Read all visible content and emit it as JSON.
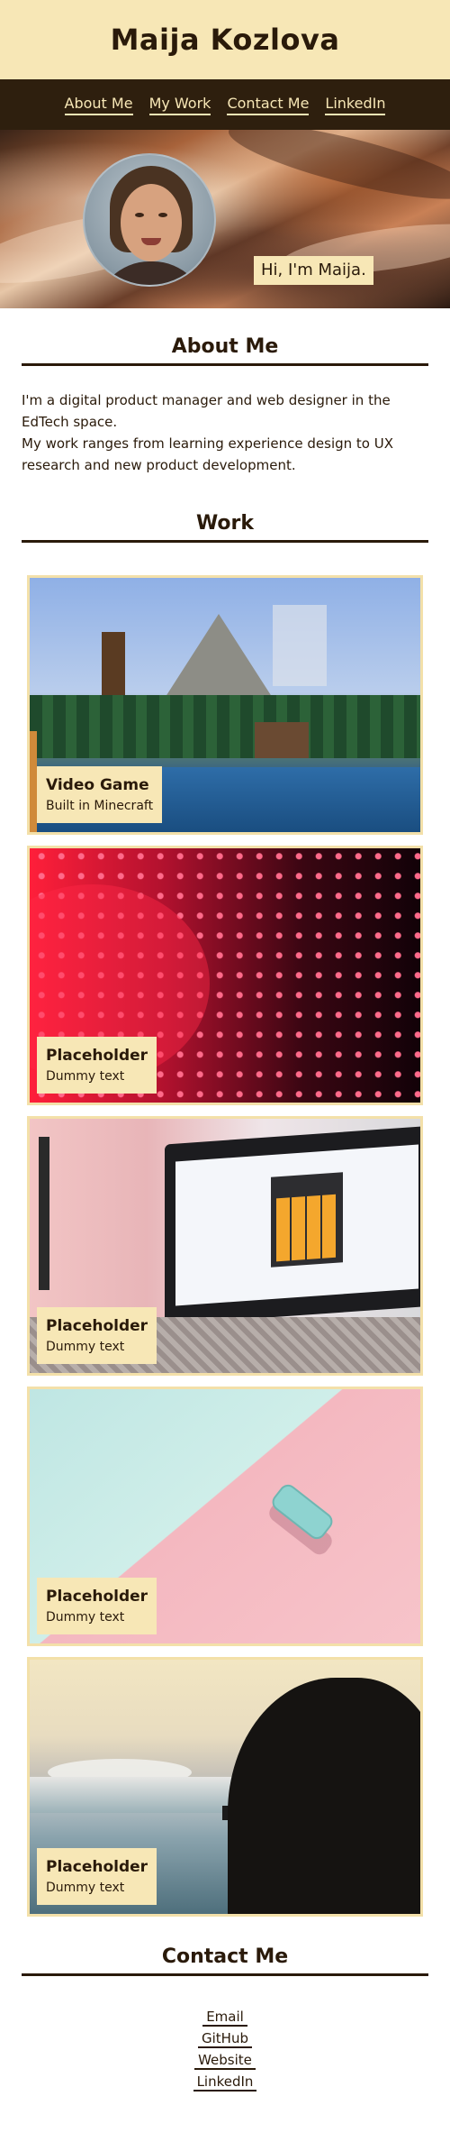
{
  "site": {
    "title": "Maija Kozlova"
  },
  "nav": {
    "items": [
      {
        "label": "About Me"
      },
      {
        "label": "My Work"
      },
      {
        "label": "Contact Me"
      },
      {
        "label": "LinkedIn"
      }
    ]
  },
  "hero": {
    "greeting": "Hi, I'm Maija."
  },
  "about": {
    "title": "About Me",
    "paragraphs": [
      "I'm a digital product manager and web designer in the EdTech space.",
      "My work ranges from learning experience design to UX research and new product development."
    ]
  },
  "work": {
    "title": "Work",
    "cards": [
      {
        "title": "Video Game",
        "subtitle": "Built in Minecraft"
      },
      {
        "title": "Placeholder",
        "subtitle": "Dummy text"
      },
      {
        "title": "Placeholder",
        "subtitle": "Dummy text"
      },
      {
        "title": "Placeholder",
        "subtitle": "Dummy text"
      },
      {
        "title": "Placeholder",
        "subtitle": "Dummy text"
      }
    ]
  },
  "contact": {
    "title": "Contact Me",
    "links": [
      {
        "label": "Email"
      },
      {
        "label": "GitHub"
      },
      {
        "label": "Website"
      },
      {
        "label": "LinkedIn"
      }
    ]
  },
  "colors": {
    "header_bg": "#f7e7b6",
    "nav_bg": "#2e1f0e",
    "text": "#2a1a0a",
    "card_border": "#f3e0a9"
  }
}
